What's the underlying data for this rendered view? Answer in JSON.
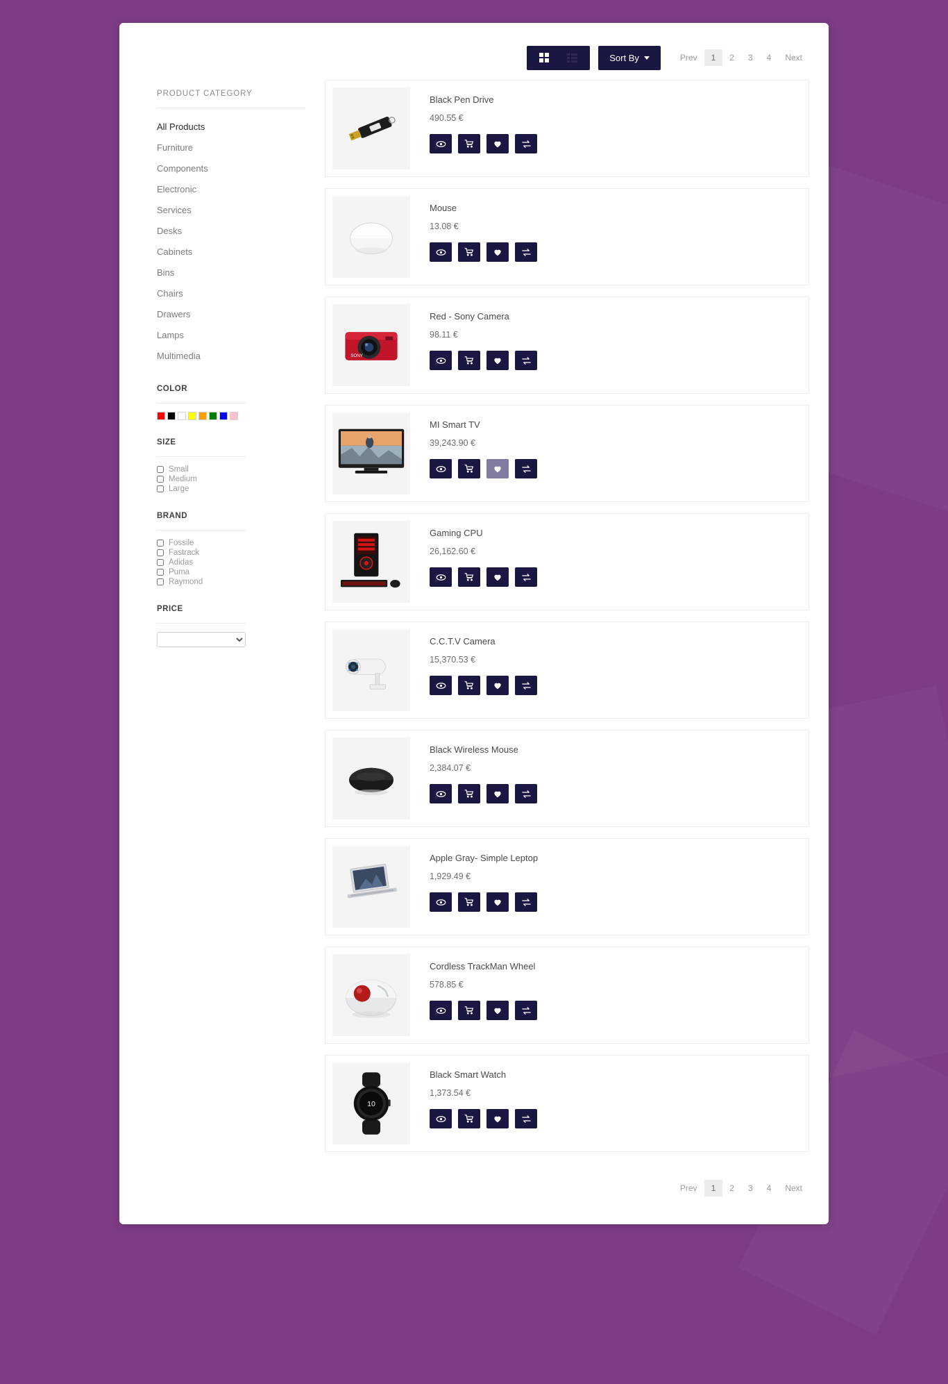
{
  "theme": {
    "background": "#7d3c85",
    "accent": "#1b1743",
    "accent_hover": "#807ca0",
    "card": "#ffffff"
  },
  "toolbar": {
    "grid_view_icon": "grid-view-icon",
    "list_view_icon": "list-view-icon",
    "sort_label": "Sort By"
  },
  "pagination": {
    "prev": "Prev",
    "next": "Next",
    "pages": [
      "1",
      "2",
      "3",
      "4"
    ],
    "active": "1"
  },
  "sidebar": {
    "category_title": "PRODUCT CATEGORY",
    "categories": [
      {
        "label": "All Products",
        "active": true
      },
      {
        "label": "Furniture",
        "active": false
      },
      {
        "label": "Components",
        "active": false
      },
      {
        "label": "Electronic",
        "active": false
      },
      {
        "label": "Services",
        "active": false
      },
      {
        "label": "Desks",
        "active": false
      },
      {
        "label": "Cabinets",
        "active": false
      },
      {
        "label": "Bins",
        "active": false
      },
      {
        "label": "Chairs",
        "active": false
      },
      {
        "label": "Drawers",
        "active": false
      },
      {
        "label": "Lamps",
        "active": false
      },
      {
        "label": "Multimedia",
        "active": false
      }
    ],
    "color": {
      "title": "COLOR",
      "swatches": [
        {
          "name": "red",
          "hex": "#fe0000"
        },
        {
          "name": "black",
          "hex": "#000000"
        },
        {
          "name": "white",
          "hex": "#ffffff"
        },
        {
          "name": "yellow",
          "hex": "#fdfd00"
        },
        {
          "name": "orange",
          "hex": "#fd9e00"
        },
        {
          "name": "green",
          "hex": "#017f01"
        },
        {
          "name": "blue",
          "hex": "#0000fe"
        },
        {
          "name": "pink",
          "hex": "#ffc0cb"
        }
      ]
    },
    "size": {
      "title": "SIZE",
      "options": [
        {
          "label": "Small",
          "checked": false
        },
        {
          "label": "Medium",
          "checked": false
        },
        {
          "label": "Large",
          "checked": false
        }
      ]
    },
    "brand": {
      "title": "BRAND",
      "options": [
        {
          "label": "Fossile",
          "checked": false
        },
        {
          "label": "Fastrack",
          "checked": false
        },
        {
          "label": "Adidas",
          "checked": false
        },
        {
          "label": "Puma",
          "checked": false
        },
        {
          "label": "Raymond",
          "checked": false
        }
      ]
    },
    "price": {
      "title": "PRICE",
      "selected": "",
      "options": [
        ""
      ]
    }
  },
  "product_actions": [
    {
      "name": "quick-view",
      "icon": "eye-icon"
    },
    {
      "name": "add-to-cart",
      "icon": "cart-icon"
    },
    {
      "name": "add-to-wishlist",
      "icon": "heart-icon"
    },
    {
      "name": "compare",
      "icon": "compare-icon"
    }
  ],
  "products": [
    {
      "name": "Black Pen Drive",
      "price": "490.55 €",
      "image": "pendrive",
      "wishlist_hover": false
    },
    {
      "name": "Mouse",
      "price": "13.08 €",
      "image": "mouse-white",
      "wishlist_hover": false
    },
    {
      "name": "Red - Sony Camera",
      "price": "98.11 €",
      "image": "camera-red",
      "wishlist_hover": false
    },
    {
      "name": "MI Smart TV",
      "price": "39,243.90 €",
      "image": "tv",
      "wishlist_hover": true
    },
    {
      "name": "Gaming CPU",
      "price": "26,162.60 €",
      "image": "gaming-pc",
      "wishlist_hover": false
    },
    {
      "name": "C.C.T.V Camera",
      "price": "15,370.53 €",
      "image": "cctv",
      "wishlist_hover": false
    },
    {
      "name": "Black Wireless Mouse",
      "price": "2,384.07 €",
      "image": "mouse-black",
      "wishlist_hover": false
    },
    {
      "name": "Apple Gray- Simple Leptop",
      "price": "1,929.49 €",
      "image": "laptop",
      "wishlist_hover": false
    },
    {
      "name": "Cordless TrackMan Wheel",
      "price": "578.85 €",
      "image": "trackball",
      "wishlist_hover": false
    },
    {
      "name": "Black Smart Watch",
      "price": "1,373.54 €",
      "image": "smartwatch",
      "wishlist_hover": false
    }
  ]
}
